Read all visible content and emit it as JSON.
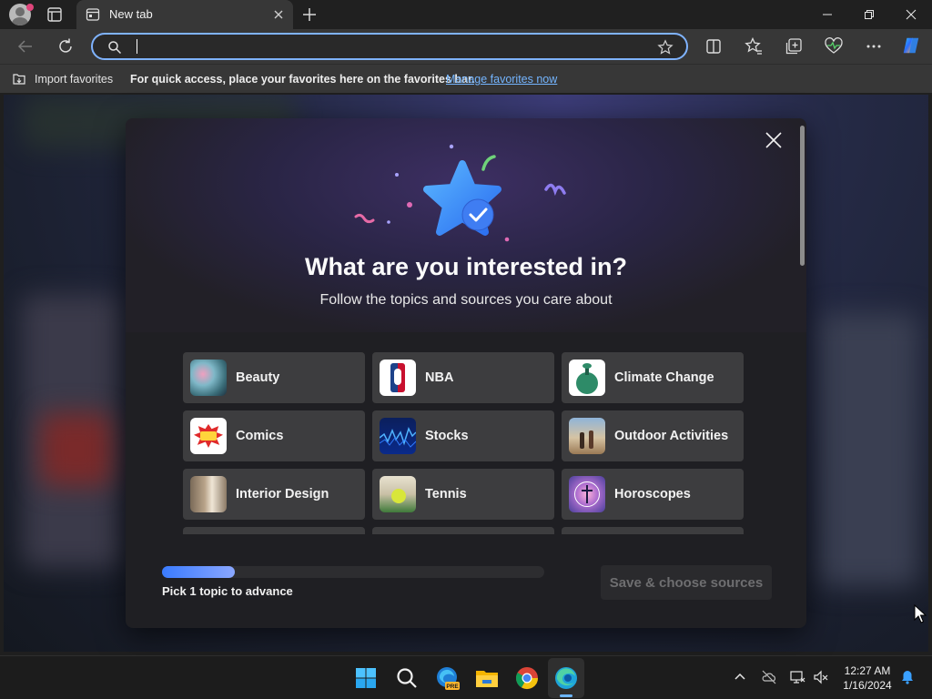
{
  "browser": {
    "tab": {
      "title": "New tab"
    },
    "address_bar": {
      "value": "",
      "placeholder": ""
    },
    "favorites_bar": {
      "import_label": "Import favorites",
      "message": "For quick access, place your favorites here on the favorites bar.",
      "manage_link": "Manage favorites now"
    }
  },
  "modal": {
    "title": "What are you interested in?",
    "subtitle": "Follow the topics and sources you care about",
    "topics": [
      {
        "label": "Beauty",
        "icon": "beauty-thumbnail"
      },
      {
        "label": "NBA",
        "icon": "nba-logo"
      },
      {
        "label": "Climate Change",
        "icon": "climate-change-thumbnail"
      },
      {
        "label": "Comics",
        "icon": "comics-thumbnail"
      },
      {
        "label": "Stocks",
        "icon": "stocks-chart-thumbnail"
      },
      {
        "label": "Outdoor Activities",
        "icon": "outdoor-activities-thumbnail"
      },
      {
        "label": "Interior Design",
        "icon": "interior-design-thumbnail"
      },
      {
        "label": "Tennis",
        "icon": "tennis-ball-thumbnail"
      },
      {
        "label": "Horoscopes",
        "icon": "horoscopes-thumbnail"
      }
    ],
    "progress": {
      "fraction": 0.19,
      "label": "Pick 1 topic to advance"
    },
    "save_button": "Save & choose sources"
  },
  "taskbar": {
    "apps": [
      "start-icon",
      "search-icon",
      "edge-preview-icon",
      "file-explorer-icon",
      "chrome-icon",
      "edge-icon"
    ],
    "clock": {
      "time": "12:27 AM",
      "date": "1/16/2024"
    }
  },
  "colors": {
    "accent": "#3a7bff",
    "address_focus": "#7fb3ff",
    "link": "#74b5ff"
  }
}
